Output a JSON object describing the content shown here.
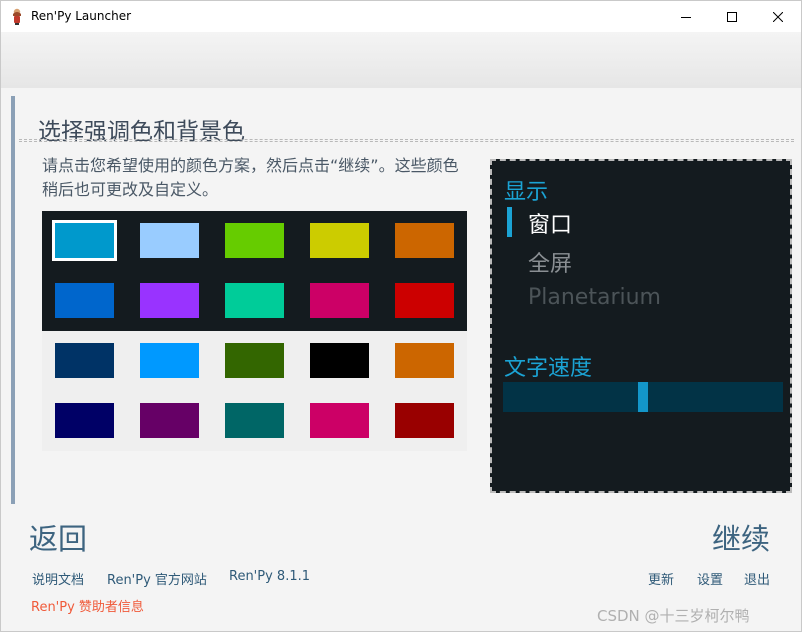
{
  "window": {
    "title": "Ren'Py Launcher"
  },
  "panel": {
    "title": "选择强调色和背景色",
    "instructions": "请点击您希望使用的颜色方案，然后点击“继续”。这些颜色稍后也可更改及自定义。"
  },
  "swatches": {
    "dark_rows": [
      [
        "#0099cc",
        "#99ccff",
        "#66cc00",
        "#cccc00",
        "#cc6600"
      ],
      [
        "#0066cc",
        "#9933ff",
        "#00cc99",
        "#cc0066",
        "#cc0000"
      ]
    ],
    "light_rows": [
      [
        "#003366",
        "#0099ff",
        "#336600",
        "#000000",
        "#cc6600"
      ],
      [
        "#000066",
        "#660066",
        "#006666",
        "#cc0066",
        "#990000"
      ]
    ],
    "selected": "dark-0-0"
  },
  "preview": {
    "section_display": "显示",
    "option_window": "窗口",
    "option_fullscreen": "全屏",
    "option_planetarium": "Planetarium",
    "section_text_speed": "文字速度",
    "text_speed_level": 0.5
  },
  "nav": {
    "back": "返回",
    "continue": "继续",
    "docs": "说明文档",
    "website": "Ren'Py 官方网站",
    "version": "Ren'Py 8.1.1",
    "update": "更新",
    "preferences": "设置",
    "quit": "退出",
    "sponsors": "Ren'Py 赞助者信息"
  },
  "watermark": "CSDN @十三岁柯尔鸭",
  "colors": {
    "accent": "#1ba3d4",
    "nav_text": "#2f5a78",
    "sponsor": "#f05a3a"
  }
}
